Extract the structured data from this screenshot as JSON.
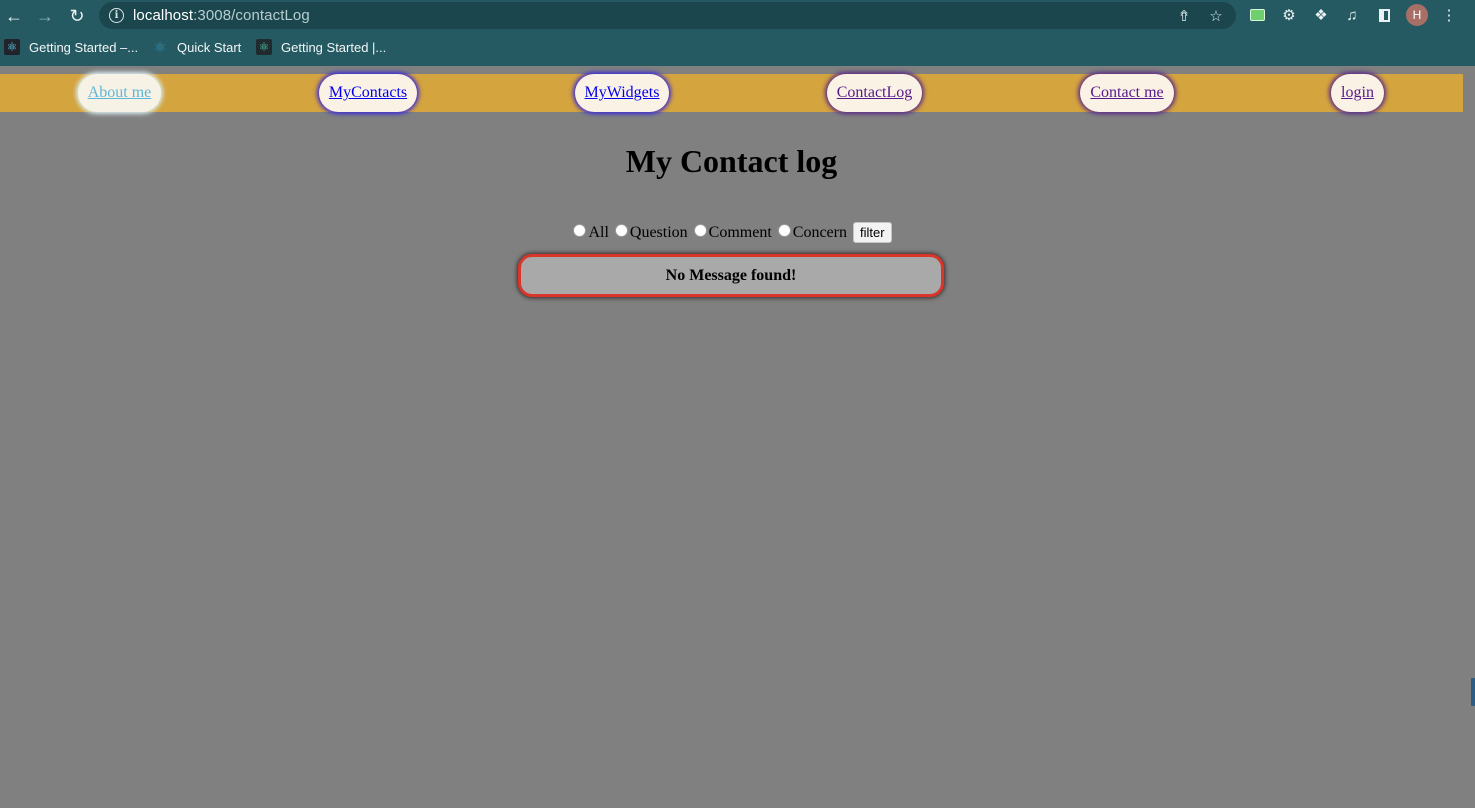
{
  "browser": {
    "url_host": "localhost",
    "url_path": ":3008/contactLog",
    "profile_initial": "H",
    "bookmarks": [
      {
        "label": "Getting Started –...",
        "icon": "react-icon"
      },
      {
        "label": "Quick Start",
        "icon": "react-icon"
      },
      {
        "label": "Getting Started |...",
        "icon": "react-icon"
      }
    ]
  },
  "nav": {
    "items": [
      {
        "label": "About me",
        "state": "active"
      },
      {
        "label": "MyContacts",
        "state": "unvisited"
      },
      {
        "label": "MyWidgets",
        "state": "unvisited"
      },
      {
        "label": "ContactLog",
        "state": "visited"
      },
      {
        "label": "Contact me",
        "state": "visited"
      },
      {
        "label": "login",
        "state": "visited"
      }
    ]
  },
  "main": {
    "title": "My Contact log",
    "filter": {
      "options": [
        "All",
        "Question",
        "Comment",
        "Concern"
      ],
      "button_label": "filter"
    },
    "message": "No Message found!"
  },
  "colors": {
    "chrome": "#255a63",
    "nav_bar": "#d4a43e",
    "page_bg": "#808080",
    "message_border": "#d9352a"
  }
}
